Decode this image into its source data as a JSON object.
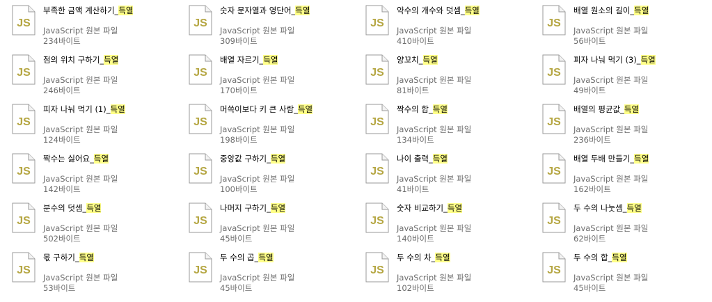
{
  "highlight_color": "#ffff88",
  "icon_text_color": "#b5a642",
  "files": [
    {
      "name": "부족한 금액 계산하기_",
      "highlight": "득열",
      "type": "JavaScript 원본 파일",
      "size": "234바이트"
    },
    {
      "name": "숫자 문자열과 영단어_",
      "highlight": "득열",
      "type": "JavaScript 원본 파일",
      "size": "309바이트"
    },
    {
      "name": "약수의 개수와 덧셈_",
      "highlight": "득열",
      "type": "JavaScript 원본 파일",
      "size": "410바이트"
    },
    {
      "name": "배열 원소의 길이_",
      "highlight": "득열",
      "type": "JavaScript 원본 파일",
      "size": "56바이트"
    },
    {
      "name": "점의 위치 구하기_",
      "highlight": "득열",
      "type": "JavaScript 원본 파일",
      "size": "246바이트"
    },
    {
      "name": "배열 자르기_",
      "highlight": "득열",
      "type": "JavaScript 원본 파일",
      "size": "170바이트"
    },
    {
      "name": "양꼬치_",
      "highlight": "득열",
      "type": "JavaScript 원본 파일",
      "size": "81바이트"
    },
    {
      "name": "피자 나눠 먹기 (3)_",
      "highlight": "득열",
      "type": "JavaScript 원본 파일",
      "size": "49바이트"
    },
    {
      "name": "피자 나눠 먹기 (1)_",
      "highlight": "득열",
      "type": "JavaScript 원본 파일",
      "size": "124바이트"
    },
    {
      "name": "머쓱이보다 키 큰 사람_",
      "highlight": "득열",
      "type": "JavaScript 원본 파일",
      "size": "198바이트"
    },
    {
      "name": "짝수의 합_",
      "highlight": "득열",
      "type": "JavaScript 원본 파일",
      "size": "134바이트"
    },
    {
      "name": "배열의 평균값_",
      "highlight": "득열",
      "type": "JavaScript 원본 파일",
      "size": "236바이트"
    },
    {
      "name": "짝수는 싫어요_",
      "highlight": "득열",
      "type": "JavaScript 원본 파일",
      "size": "142바이트"
    },
    {
      "name": "중앙값 구하기_",
      "highlight": "득열",
      "type": "JavaScript 원본 파일",
      "size": "100바이트"
    },
    {
      "name": "나이 출력_",
      "highlight": "득열",
      "type": "JavaScript 원본 파일",
      "size": "41바이트"
    },
    {
      "name": "배열 두배 만들기_",
      "highlight": "득열",
      "type": "JavaScript 원본 파일",
      "size": "162바이트"
    },
    {
      "name": "분수의 덧셈_",
      "highlight": "득열",
      "type": "JavaScript 원본 파일",
      "size": "502바이트"
    },
    {
      "name": "나머지 구하기_",
      "highlight": "득열",
      "type": "JavaScript 원본 파일",
      "size": "45바이트"
    },
    {
      "name": "숫자 비교하기_",
      "highlight": "득열",
      "type": "JavaScript 원본 파일",
      "size": "140바이트"
    },
    {
      "name": "두 수의 나눗셈_",
      "highlight": "득열",
      "type": "JavaScript 원본 파일",
      "size": "62바이트"
    },
    {
      "name": "몫 구하기_",
      "highlight": "득열",
      "type": "JavaScript 원본 파일",
      "size": "53바이트"
    },
    {
      "name": "두 수의 곱_",
      "highlight": "득열",
      "type": "JavaScript 원본 파일",
      "size": "45바이트"
    },
    {
      "name": "두 수의 차_",
      "highlight": "득열",
      "type": "JavaScript 원본 파일",
      "size": "102바이트"
    },
    {
      "name": "두 수의 합_",
      "highlight": "득열",
      "type": "JavaScript 원본 파일",
      "size": "45바이트"
    }
  ],
  "icon": {
    "name": "js-file-icon",
    "label": "JS"
  }
}
